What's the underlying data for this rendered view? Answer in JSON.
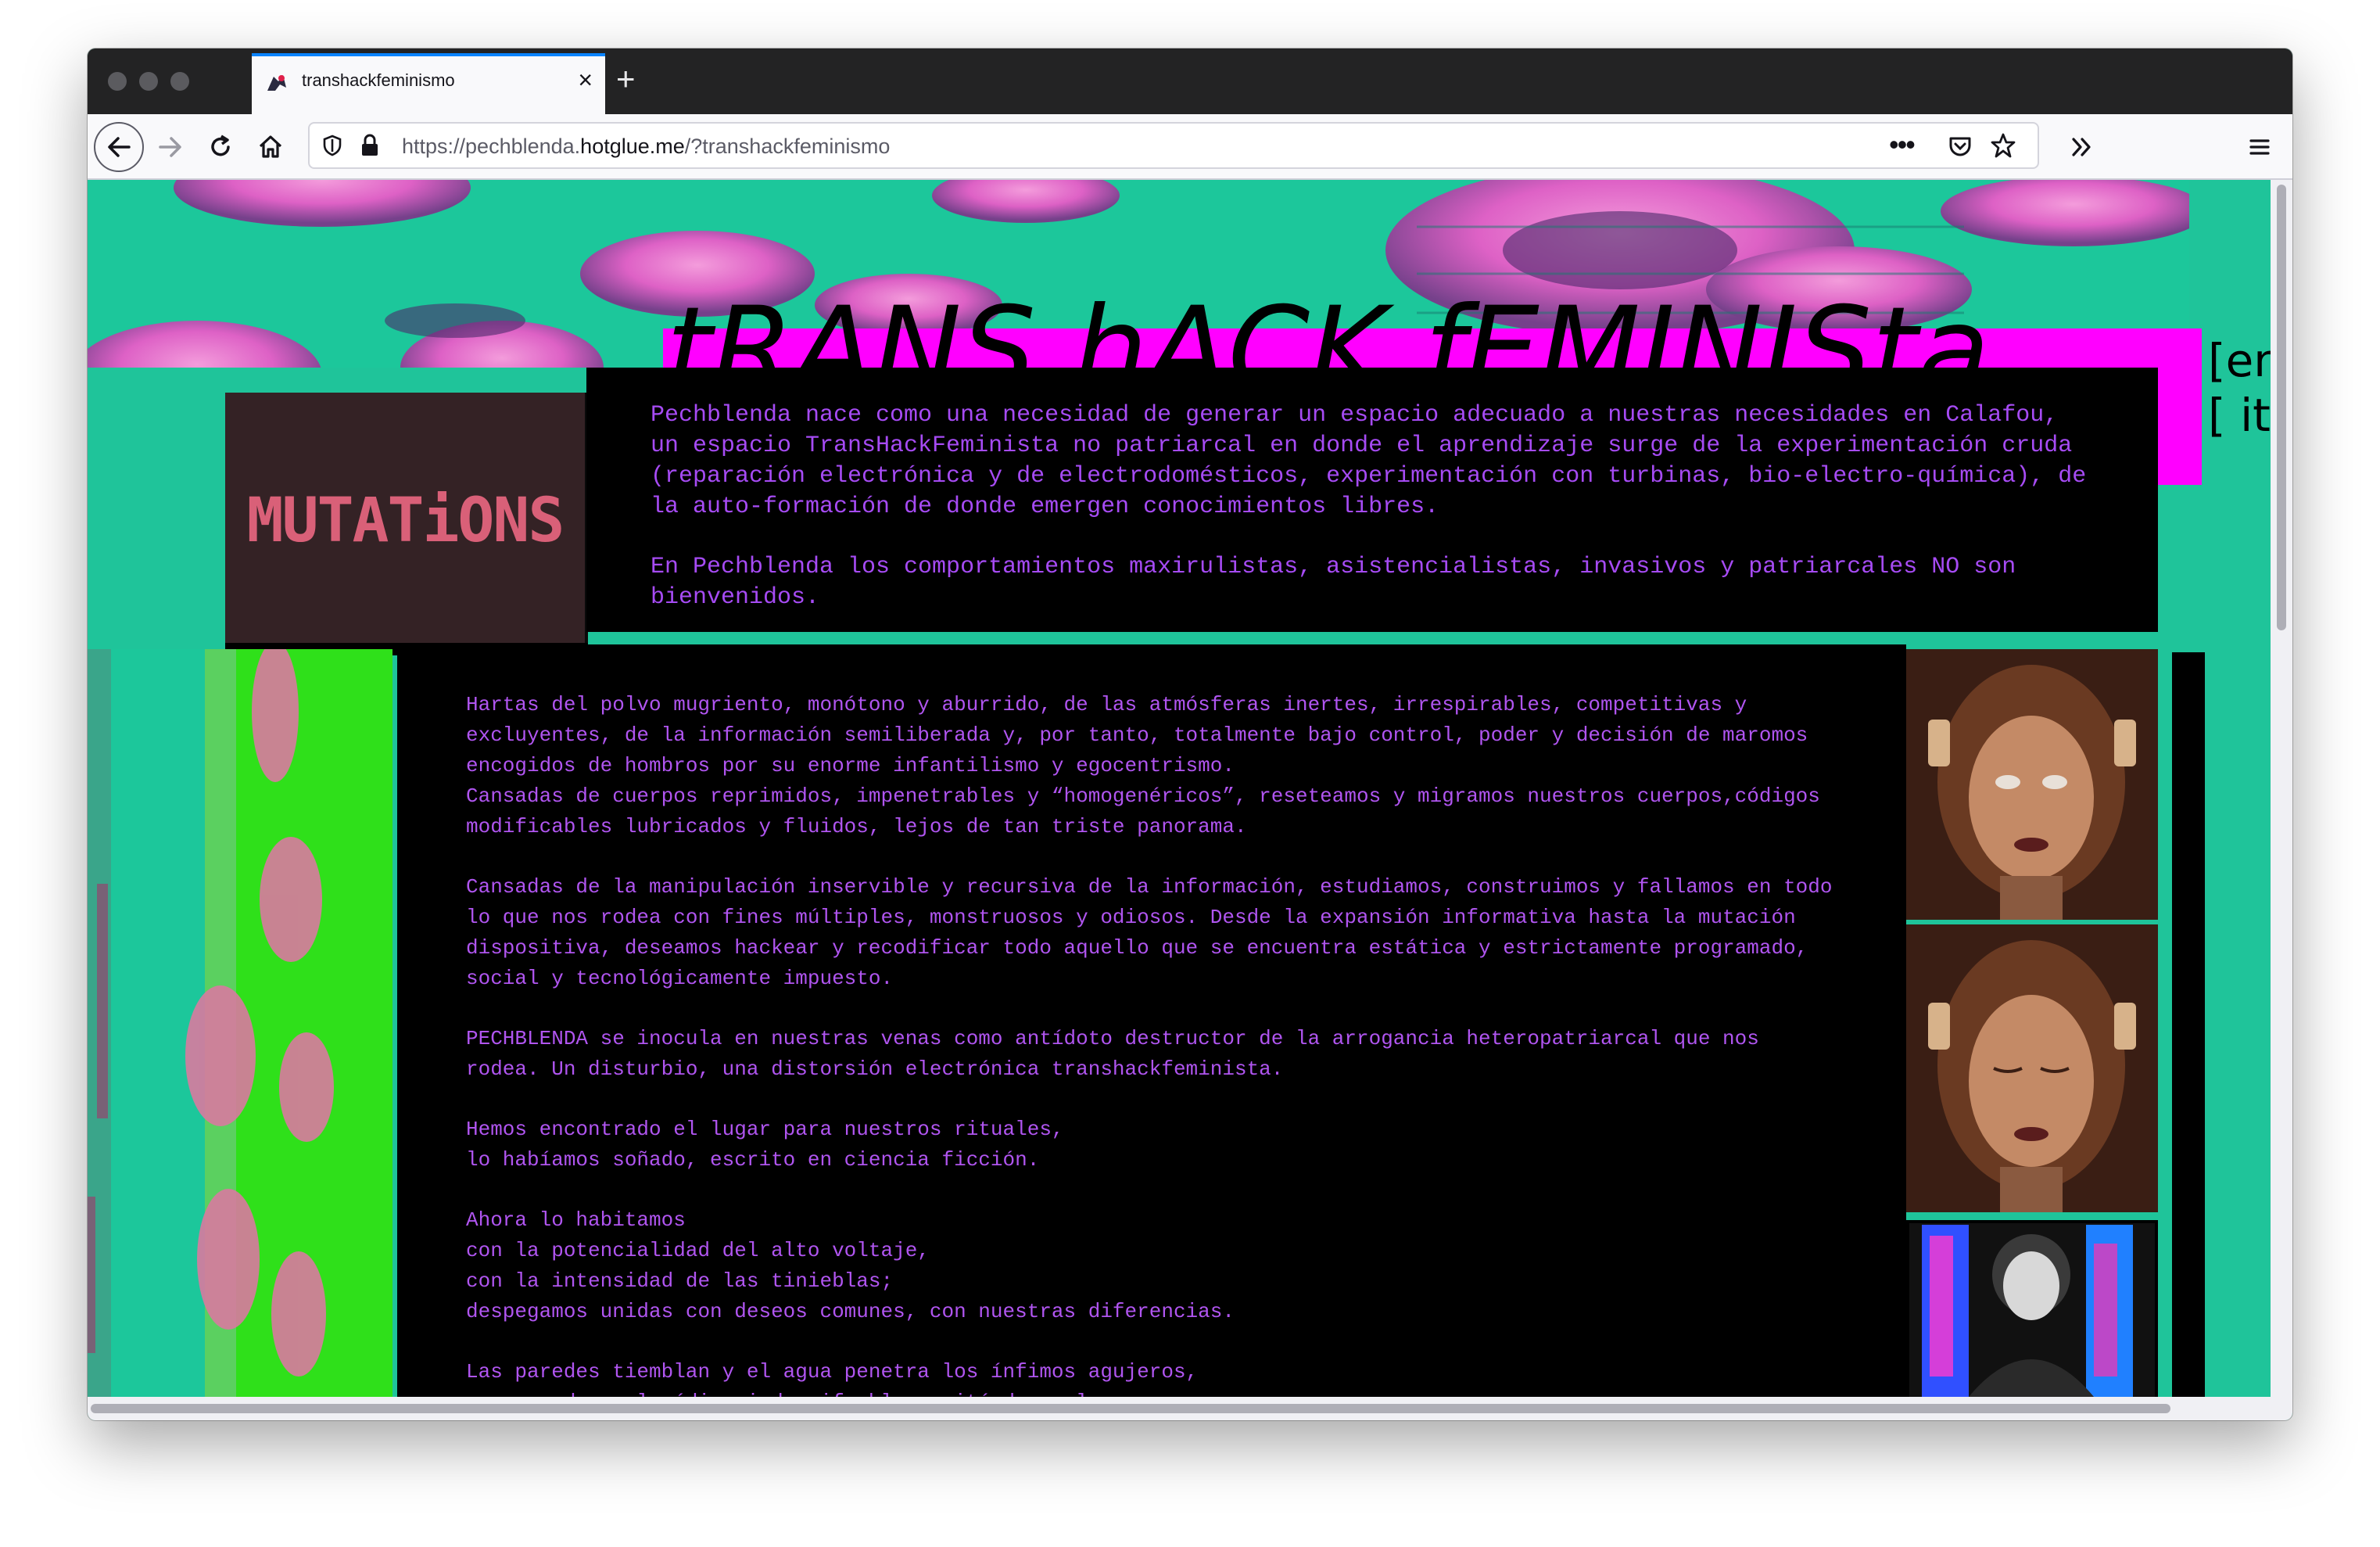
{
  "browser": {
    "tab_title": "transhackfeminismo",
    "url_prefix": "https://pechblenda.",
    "url_domain": "hotglue.me",
    "url_suffix": "/?transhackfeminismo"
  },
  "page": {
    "title": "tRANS hACK fEMINISta",
    "lang_line1": "[en",
    "lang_line2": "[ it",
    "mutations_label": "MUTATiONS",
    "intro": [
      "Pechblenda nace como una necesidad de generar un espacio adecuado a nuestras necesidades en Calafou, un espacio TransHackFeminista no patriarcal en donde el aprendizaje surge de la experimentación cruda (reparación electrónica y de electrodomésticos, experimentación con turbinas, bio-electro-química), de la auto-formación de donde emergen conocimientos libres.",
      "En Pechblenda los comportamientos maxirulistas, asistencialistas, invasivos y patriarcales NO son bienvenidos."
    ],
    "manifesto": [
      "Hartas del polvo mugriento, monótono y aburrido, de las atmósferas inertes, irrespirables, competitivas y excluyentes, de la información semiliberada y, por tanto, totalmente bajo control, poder y decisión de maromos encogidos de hombros por su enorme infantilismo y egocentrismo.\nCansadas de cuerpos reprimidos, impenetrables y “homogenéricos”, reseteamos y migramos nuestros cuerpos,códigos modificables lubricados y fluidos, lejos de tan triste panorama.",
      "Cansadas de la manipulación inservible y recursiva de la información, estudiamos, construimos y fallamos en todo lo que nos rodea con fines múltiples, monstruosos y odiosos. Desde la expansión informativa hasta la mutación dispositiva, deseamos hackear y recodificar todo aquello que se encuentra estática y estrictamente programado, social y tecnológicamente impuesto.",
      "PECHBLENDA se inocula en nuestras venas como antídoto destructor de la arrogancia heteropatriarcal que nos rodea. Un disturbio, una distorsión electrónica transhackfeminista.",
      "Hemos encontrado el lugar para nuestros rituales,\nlo habíamos soñado, escrito en ciencia ficción.",
      "Ahora lo habitamos\ncon la potencialidad del alto voltaje,\ncon la intensidad de las tinieblas;\ndespegamos unidas con deseos comunes, con nuestras diferencias.",
      "Las paredes tiemblan y el agua penetra los ínfimos agujeros,\nse expande cual código indescifrable excitándonos las neuronas;"
    ]
  },
  "colors": {
    "background": "#1fc49a",
    "magenta": "#ff00ff",
    "text_purple": "#b055f0",
    "tab_accent": "#0a84ff"
  }
}
